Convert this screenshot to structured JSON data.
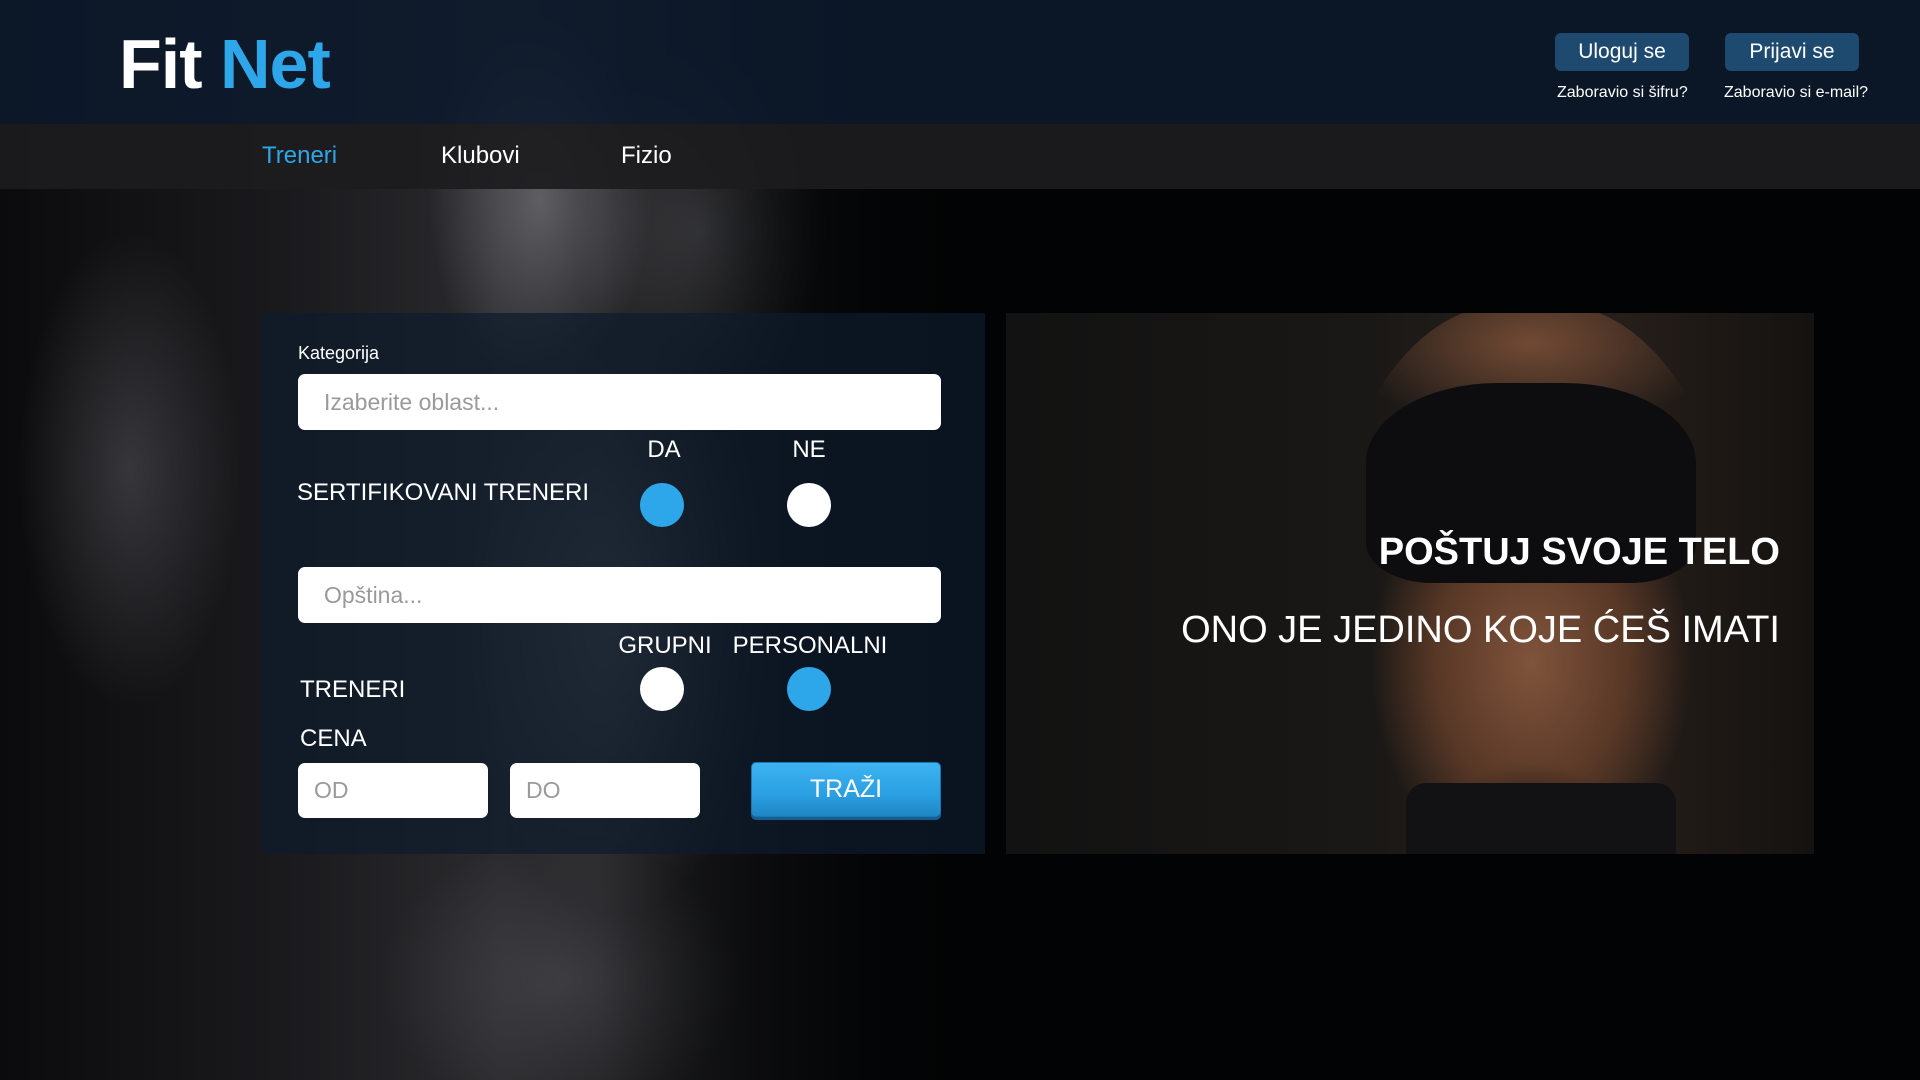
{
  "header": {
    "logo_part1": "Fit",
    "logo_part2": "Net",
    "login_label": "Uloguj se",
    "register_label": "Prijavi se",
    "forgot_password": "Zaboravio si šifru?",
    "forgot_email": "Zaboravio si e-mail?"
  },
  "nav": {
    "items": [
      {
        "label": "Treneri",
        "active": true
      },
      {
        "label": "Klubovi",
        "active": false
      },
      {
        "label": "Fizio",
        "active": false
      }
    ]
  },
  "search_form": {
    "category_label": "Kategorija",
    "category_placeholder": "Izaberite oblast...",
    "certified": {
      "label": "SERTIFIKOVANI TRENERI",
      "option_yes": "DA",
      "option_no": "NE",
      "selected": "DA"
    },
    "municipality_placeholder": "Opština...",
    "trainers": {
      "label": "TRENERI",
      "option_group": "GRUPNI",
      "option_personal": "PERSONALNI",
      "selected": "PERSONALNI"
    },
    "price_label": "CENA",
    "price_from_placeholder": "OD",
    "price_to_placeholder": "DO",
    "search_button": "TRAŽI"
  },
  "hero": {
    "title": "POŠTUJ SVOJE TELO",
    "subtitle": "ONO JE JEDINO KOJE  ĆEŠ IMATI"
  },
  "colors": {
    "accent": "#2ea6ea",
    "header_bg": "#0c1a2c",
    "nav_bg": "#1c1c1e",
    "button_bg": "#1e4a70"
  }
}
